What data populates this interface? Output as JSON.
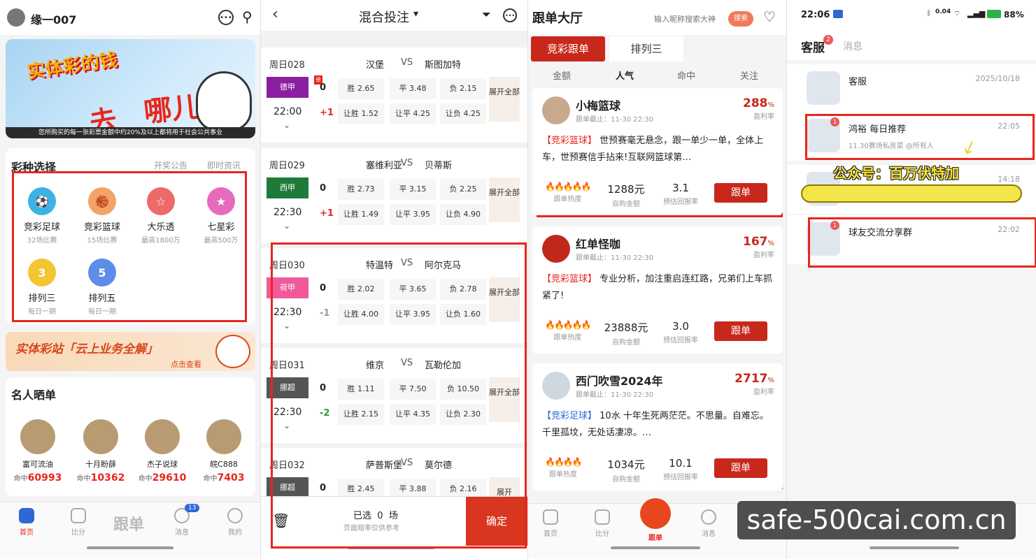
{
  "p1": {
    "username": "缘一007",
    "banner_line1": "实体彩的钱",
    "banner_line2": "去",
    "banner_line3": "哪儿了？",
    "banner_foot": "您所购买的每一张彩票金额中约20%及以上都将用于社会公共事业",
    "lottery_title": "彩种选择",
    "link_notice": "开奖公告",
    "link_news": "即时资讯",
    "lotteries": [
      {
        "name": "竞彩足球",
        "sub": "32场比赛",
        "color": "#3bb3e6",
        "glyph": "⚽"
      },
      {
        "name": "竞彩篮球",
        "sub": "15场比赛",
        "color": "#f3a36a",
        "glyph": "🏀"
      },
      {
        "name": "大乐透",
        "sub": "最高1800万",
        "color": "#ee6a6a",
        "glyph": "☆"
      },
      {
        "name": "七星彩",
        "sub": "最高500万",
        "color": "#e76bbd",
        "glyph": "★"
      },
      {
        "name": "排列三",
        "sub": "每日一期",
        "color": "#f2c531",
        "glyph": "3"
      },
      {
        "name": "排列五",
        "sub": "每日一期",
        "color": "#5d8de8",
        "glyph": "5"
      }
    ],
    "promo_title": "实体彩站「云上业务全解」",
    "promo_link": "点击查看",
    "stars_title": "名人晒单",
    "stars": [
      {
        "name": "富可流油",
        "hit_label": "命中",
        "hit": "60993"
      },
      {
        "name": "十月盼薛",
        "hit_label": "命中",
        "hit": "10362"
      },
      {
        "name": "杰子说球",
        "hit_label": "命中",
        "hit": "29610"
      },
      {
        "name": "皖C888",
        "hit_label": "命中",
        "hit": "7403"
      }
    ],
    "tabs": {
      "home": "首页",
      "score": "比分",
      "follow": "跟单",
      "msg": "消息",
      "msg_badge": "13",
      "me": "我的"
    }
  },
  "p2": {
    "title": "混合投注",
    "matches": [
      {
        "day": "周日028",
        "home": "汉堡",
        "vs": "VS",
        "away": "斯图加特",
        "league": "德甲",
        "league_color": "#8c1ea1",
        "time": "22:00",
        "h0": "0",
        "h1": "+1",
        "h1_color": "#e8261c",
        "o1": "胜 2.65",
        "o2": "平 3.48",
        "o3": "负 2.15",
        "o4": "让胜 1.52",
        "o5": "让平 4.25",
        "o6": "让负 4.25",
        "more": "展开全部",
        "has_tag": true,
        "tag": "单"
      },
      {
        "day": "周日029",
        "home": "塞维利亚",
        "vs": "VS",
        "away": "贝蒂斯",
        "league": "西甲",
        "league_color": "#1f7a3a",
        "time": "22:30",
        "h0": "0",
        "h1": "+1",
        "h1_color": "#e8261c",
        "o1": "胜 2.73",
        "o2": "平 3.15",
        "o3": "负 2.25",
        "o4": "让胜 1.49",
        "o5": "让平 3.95",
        "o6": "让负 4.90",
        "more": "展开全部"
      },
      {
        "day": "周日030",
        "home": "特温特",
        "vs": "VS",
        "away": "阿尔克马",
        "league": "荷甲",
        "league_color": "#f05a9b",
        "time": "22:30",
        "h0": "0",
        "h1": "-1",
        "h1_color": "#999999",
        "o1": "胜 2.02",
        "o2": "平 3.65",
        "o3": "负 2.78",
        "o4": "让胜 4.00",
        "o5": "让平 3.95",
        "o6": "让负 1.60",
        "more": "展开全部"
      },
      {
        "day": "周日031",
        "home": "维京",
        "vs": "VS",
        "away": "瓦勒伦加",
        "league": "挪超",
        "league_color": "#555555",
        "time": "22:30",
        "h0": "0",
        "h1": "-2",
        "h1_color": "#2a9a3a",
        "o1": "胜 1.11",
        "o2": "平 7.50",
        "o3": "负 10.50",
        "o4": "让胜 2.15",
        "o5": "让平 4.35",
        "o6": "让负 2.30",
        "more": "展开全部"
      },
      {
        "day": "周日032",
        "home": "萨普斯堡",
        "vs": "VS",
        "away": "莫尔德",
        "league": "挪超",
        "league_color": "#555555",
        "h0": "0",
        "o1": "胜 2.45",
        "o2": "平 3.88",
        "o3": "负 2.16",
        "more": "展开"
      }
    ],
    "selected": "已选",
    "selected_count": "0",
    "selected_unit": "场",
    "note": "页面赔率仅供参考",
    "confirm": "确定"
  },
  "p3": {
    "title": "跟单大厅",
    "search_placeholder": "输入昵称搜索大神",
    "search_btn": "搜索",
    "tab_active": "竞彩跟单",
    "tab_other": "排列三",
    "sort_tabs": [
      "金额",
      "人气",
      "命中",
      "关注"
    ],
    "posts": [
      {
        "name": "小梅篮球",
        "deadline": "跟单截止：11-30 22:30",
        "rate": "288",
        "pct": "%",
        "rate_label": "盈利率",
        "tag": "【竞彩篮球】",
        "text": " 世预赛毫无悬念，跟一单少一单，全体上车，世预赛信手拈来!互联网篮球第…",
        "fire": "🔥🔥🔥🔥🔥",
        "fire_label": "跟单热度",
        "amount": "1288元",
        "amount_label": "自购金额",
        "ret": "3.1",
        "ret_label": "预估回报率",
        "btn": "跟单",
        "tag_color": "#e8261c",
        "av": "#c9a98b"
      },
      {
        "name": "红单怪咖",
        "deadline": "跟单截止：11-30 22:30",
        "rate": "167",
        "pct": "%",
        "rate_label": "盈利率",
        "tag": "【竞彩篮球】",
        "text": " 专业分析，加注重启连红路，兄弟们上车抓紧了!",
        "fire": "🔥🔥🔥🔥🔥",
        "fire_label": "跟单热度",
        "amount": "23888元",
        "amount_label": "自购金额",
        "ret": "3.0",
        "ret_label": "预估回报率",
        "btn": "跟单",
        "tag_color": "#e8261c",
        "av": "#c0281c"
      },
      {
        "name": "西门吹雪2024年",
        "deadline": "跟单截止：11-30 22:30",
        "rate": "2717",
        "pct": "%",
        "rate_label": "盈利率",
        "tag": "【竞彩足球】",
        "text": " 10水 十年生死两茫茫。不思量。自难忘。千里孤坟，无处话凄凉。…",
        "fire": "🔥🔥🔥🔥",
        "fire_label": "跟单热度",
        "amount": "1034元",
        "amount_label": "自购金额",
        "ret": "10.1",
        "ret_label": "预估回报率",
        "btn": "跟单",
        "tag_color": "#2d68d6",
        "av": "#cfd8df"
      }
    ],
    "tabs": {
      "home": "首页",
      "score": "比分",
      "follow": "跟单",
      "msg": "消息"
    }
  },
  "p4": {
    "time": "22:06",
    "battery": "88%",
    "net": "0.04",
    "tab_active": "客服",
    "tab_badge": "2",
    "tab_other": "消息",
    "chats": [
      {
        "name": "客服",
        "sub": "",
        "time": "2025/10/18",
        "dot": ""
      },
      {
        "name": "鸿裕 每日推荐",
        "sub": "11.30赛场私房菜 @所有人",
        "time": "22:05",
        "dot": "1"
      },
      {
        "name": "",
        "sub": "就当扶贫啊 吸取经验了，大神",
        "time": "14:18",
        "dot": ""
      },
      {
        "name": "球友交流分享群",
        "sub": "",
        "time": "22:02",
        "dot": "1"
      }
    ],
    "watermark": "公众号：百万伏特加"
  },
  "site": "safe-500cai.com.cn",
  "colors": {
    "brand_red": "#c8281c",
    "highlight_box": "#e8261c"
  }
}
